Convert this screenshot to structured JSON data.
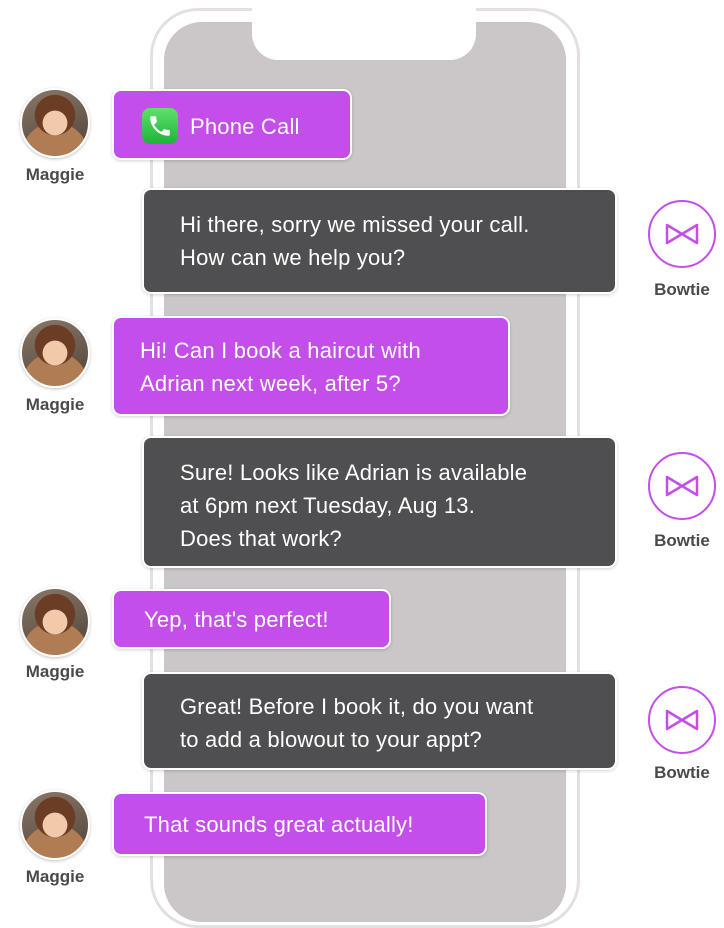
{
  "messages": [
    {
      "id": "m1",
      "from": "user",
      "name": "Maggie",
      "icon": "phone-icon",
      "lines": [
        "Phone Call"
      ]
    },
    {
      "id": "m2",
      "from": "bot",
      "name": "Bowtie",
      "lines": [
        "Hi there, sorry we missed your call.",
        "How can we help you?"
      ]
    },
    {
      "id": "m3",
      "from": "user",
      "name": "Maggie",
      "lines": [
        "Hi! Can I book a haircut with",
        "Adrian next week, after 5?"
      ]
    },
    {
      "id": "m4",
      "from": "bot",
      "name": "Bowtie",
      "lines": [
        "Sure! Looks like Adrian is available",
        "at 6pm next Tuesday, Aug 13.",
        "Does that work?"
      ]
    },
    {
      "id": "m5",
      "from": "user",
      "name": "Maggie",
      "lines": [
        "Yep, that's perfect!"
      ]
    },
    {
      "id": "m6",
      "from": "bot",
      "name": "Bowtie",
      "lines": [
        "Great! Before I book it, do you want",
        "to add a blowout to your appt?"
      ]
    },
    {
      "id": "m7",
      "from": "user",
      "name": "Maggie",
      "lines": [
        "That sounds great actually!"
      ]
    }
  ],
  "colors": {
    "user_bubble": "#c34ee9",
    "bot_bubble": "#4f4e50",
    "screen": "#cbc6c7",
    "accent": "#c34ee9"
  }
}
